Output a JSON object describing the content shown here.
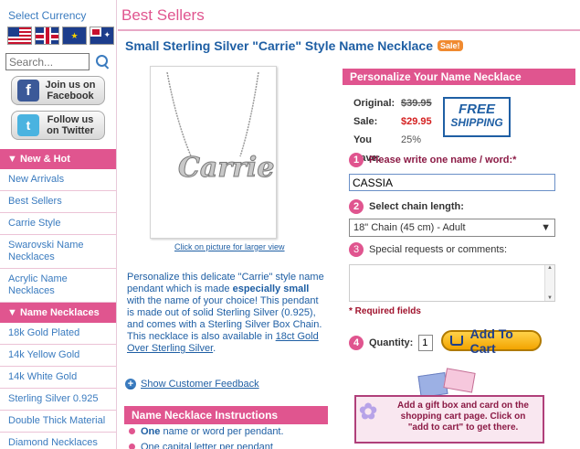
{
  "sidebar": {
    "currency_title": "Select Currency",
    "flags": [
      "us-flag-icon",
      "uk-flag-icon",
      "eu-flag-icon",
      "au-flag-icon"
    ],
    "eu_stars": "★",
    "search_placeholder": "Search...",
    "facebook_label": "Join us on Facebook",
    "facebook_letter": "f",
    "twitter_label": "Follow us on Twitter",
    "twitter_letter": "t",
    "section1": "▼ New & Hot",
    "section1_items": [
      "New Arrivals",
      "Best Sellers",
      "Carrie Style",
      "Swarovski Name Necklaces",
      "Acrylic Name Necklaces"
    ],
    "section2": "▼ Name Necklaces",
    "section2_items": [
      "18k Gold Plated",
      "14k Yellow Gold",
      "14k White Gold",
      "Sterling Silver 0.925",
      "Double Thick Material",
      "Diamond Necklaces"
    ]
  },
  "header": {
    "title": "Best Sellers"
  },
  "product": {
    "title": "Small Sterling Silver \"Carrie\" Style Name Necklace",
    "badge": "Sale!",
    "image_text": "Carrie",
    "image_caption": "Click on picture for larger view",
    "desc_1": "Personalize this delicate \"Carrie\" style name pendant which is made ",
    "desc_bold": "especially small",
    "desc_2": " with the name of your choice! This pendant is made out of solid Sterling Silver (0.925), and comes with a Sterling Silver Box Chain. This necklace is also available in ",
    "desc_link": "18ct Gold Over Sterling Silver",
    "desc_3": ".",
    "feedback": "Show Customer Feedback",
    "instructions_title": "Name Necklace Instructions",
    "instruction_1_bold": "One",
    "instruction_1_rest": " name or word per pendant.",
    "instruction_2": "One capital letter per pendant"
  },
  "personalize": {
    "title": "Personalize Your Name Necklace",
    "original_label": "Original:",
    "original_price": "$39.95",
    "sale_label": "Sale:",
    "sale_price": "$29.95",
    "save_label": "You Save:",
    "save_value": "25%",
    "free_1": "FREE",
    "free_2": "SHIPPING",
    "step1_num": "1",
    "step1": "Please write one name / word:*",
    "name_value": "CASSIA",
    "step2_num": "2",
    "step2": "Select chain length:",
    "chain_value": "18\" Chain (45 cm) - Adult",
    "step3_num": "3",
    "step3": "Special requests or comments:",
    "comments_value": "",
    "required": "* Required fields",
    "step4_num": "4",
    "quantity_label": "Quantity:",
    "quantity_value": "1",
    "cart_button": "Add To Cart",
    "gift_text": "Add a gift box and card on the shopping cart page. Click on \"add to cart\" to get there."
  },
  "colors": {
    "accent": "#e0558f",
    "link": "#1f5fa4",
    "sale": "#d42020"
  }
}
